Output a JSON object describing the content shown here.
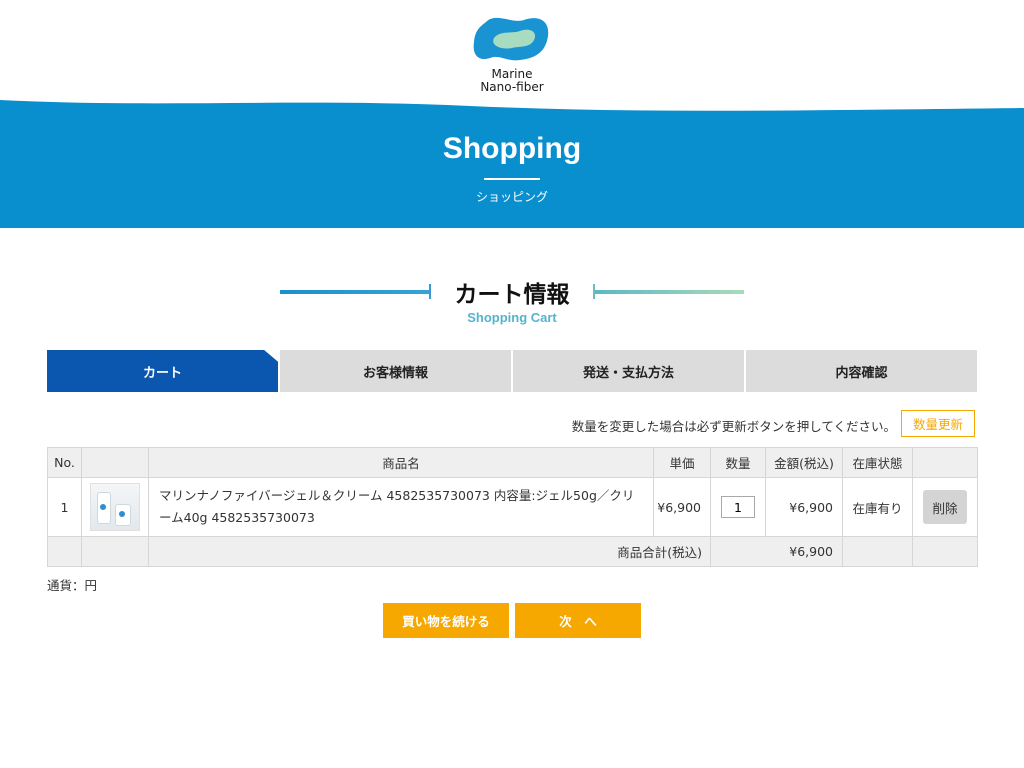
{
  "brand": {
    "logo_line1": "Marine",
    "logo_line2": "Nano-fiber",
    "colors": {
      "primary_blue": "#0a8fce",
      "step_active": "#0b56ae",
      "accent_orange": "#f6a800",
      "logo_green": "#a8dcc0"
    }
  },
  "hero": {
    "title": "Shopping",
    "subtitle": "ショッピング"
  },
  "section": {
    "title": "カート情報",
    "subtitle": "Shopping Cart"
  },
  "steps": [
    {
      "label": "カート",
      "active": true
    },
    {
      "label": "お客様情報",
      "active": false
    },
    {
      "label": "発送・支払方法",
      "active": false
    },
    {
      "label": "内容確認",
      "active": false
    }
  ],
  "update_notice": "数量を変更した場合は必ず更新ボタンを押してください。",
  "update_button": "数量更新",
  "table": {
    "headers": {
      "no": "No.",
      "image": "",
      "name": "商品名",
      "price": "単価",
      "qty": "数量",
      "amount": "金額(税込)",
      "stock": "在庫状態",
      "action": ""
    },
    "rows": [
      {
        "no": "1",
        "image_icon": "product-thumbnail",
        "name": "マリンナノファイバージェル＆クリーム 4582535730073 内容量:ジェル50g／クリーム40g 4582535730073",
        "price": "¥6,900",
        "qty": "1",
        "amount": "¥6,900",
        "stock": "在庫有り",
        "delete_label": "削除"
      }
    ],
    "total_label": "商品合計(税込)",
    "total_value": "¥6,900"
  },
  "currency_note": "通貨：円",
  "buttons": {
    "continue_shopping": "買い物を続ける",
    "next": "次　へ"
  }
}
